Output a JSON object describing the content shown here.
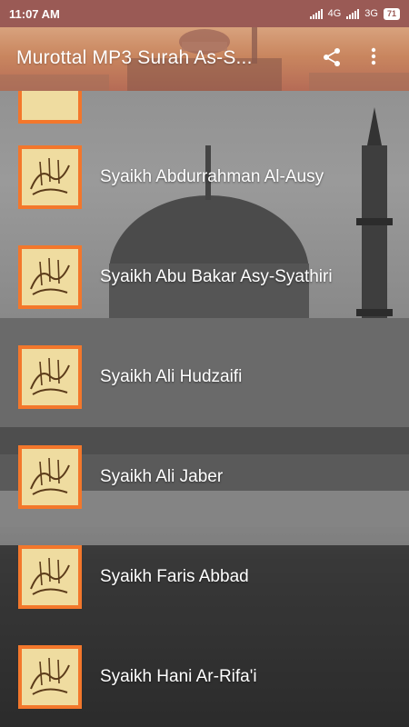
{
  "status_bar": {
    "time": "11:07 AM",
    "network_1": "4G",
    "network_2": "3G",
    "battery": "71"
  },
  "toolbar": {
    "title": "Murottal MP3 Surah As-S...",
    "share_icon": "share-icon",
    "more_icon": "more-vert-icon"
  },
  "list": {
    "items": [
      {
        "label": ""
      },
      {
        "label": "Syaikh Abdurrahman Al-Ausy"
      },
      {
        "label": "Syaikh Abu Bakar Asy-Syathiri"
      },
      {
        "label": "Syaikh Ali Hudzaifi"
      },
      {
        "label": "Syaikh Ali Jaber"
      },
      {
        "label": "Syaikh Faris Abbad"
      },
      {
        "label": "Syaikh Hani Ar-Rifa'i"
      }
    ]
  },
  "colors": {
    "status_bar": "#9a5a55",
    "thumb_border": "#f3772b",
    "thumb_fill": "#efdca0",
    "text": "#ffffff"
  }
}
